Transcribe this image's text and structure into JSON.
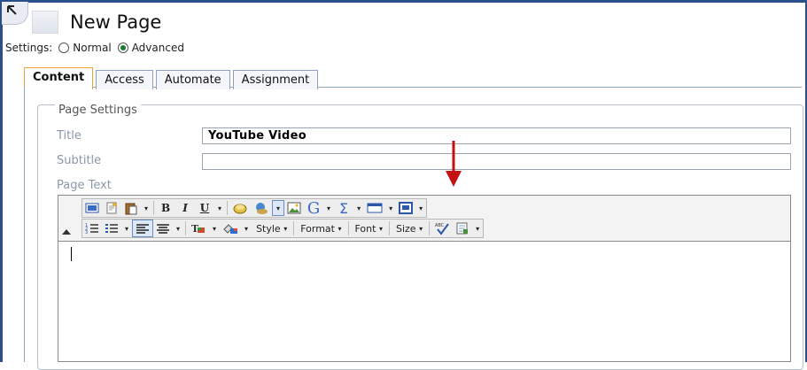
{
  "header": {
    "title": "New Page",
    "settings_label": "Settings:",
    "mode_options": [
      {
        "label": "Normal",
        "selected": false
      },
      {
        "label": "Advanced",
        "selected": true
      }
    ]
  },
  "tabs": [
    {
      "label": "Content",
      "active": true
    },
    {
      "label": "Access",
      "active": false
    },
    {
      "label": "Automate",
      "active": false
    },
    {
      "label": "Assignment",
      "active": false
    }
  ],
  "page_settings": {
    "legend": "Page Settings",
    "title_label": "Title",
    "title_value": "YouTube Video",
    "subtitle_label": "Subtitle",
    "subtitle_value": "",
    "page_text_label": "Page Text"
  },
  "editor_toolbar": {
    "row2_dropdowns": [
      "Style",
      "Format",
      "Font",
      "Size"
    ],
    "dropdown_arrow": "▾",
    "icons_row1": [
      "source-view-icon",
      "paste-icon",
      "paste-special-icon",
      "bold-icon",
      "italic-icon",
      "underline-icon",
      "font-effects-icon",
      "insert-link-icon",
      "insert-object-icon",
      "insert-image-icon",
      "insert-media-icon",
      "insert-formula-icon",
      "insert-table-icon",
      "template-icon"
    ],
    "icons_row2": [
      "ordered-list-icon",
      "unordered-list-icon",
      "align-left-icon",
      "align-center-icon",
      "text-color-icon",
      "background-color-icon",
      "spellcheck-icon",
      "document-properties-icon"
    ],
    "bold_glyph": "B",
    "italic_glyph": "I",
    "underline_glyph": "U",
    "sigma_glyph": "Σ",
    "spell_glyph": "ABC"
  },
  "colors": {
    "frame": "#2b4f8a",
    "tab_active_border": "#f0a030",
    "label_grey": "#8b98aa",
    "annotation_arrow": "#c41212"
  }
}
